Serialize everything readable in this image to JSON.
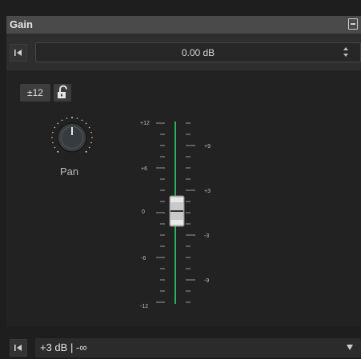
{
  "panel": {
    "title": "Gain",
    "value": "0.00 dB",
    "range_button": "±12",
    "knob_label": "Pan",
    "preset": "+3 dB | -∞"
  },
  "fader": {
    "left_scale": [
      "+12",
      "+6",
      "0",
      "-6",
      "-12"
    ],
    "right_scale": [
      "+9",
      "+3",
      "-3",
      "-9"
    ],
    "position_db": 0,
    "range_db": [
      -12,
      12
    ]
  },
  "colors": {
    "accent": "#24b35e",
    "panel_bg": "#222222",
    "titlebar": "#4a4a4a"
  },
  "icons": [
    "collapse-icon",
    "reset-icon",
    "spin-arrows-icon",
    "lock-open-icon",
    "dropdown-arrow-icon"
  ]
}
